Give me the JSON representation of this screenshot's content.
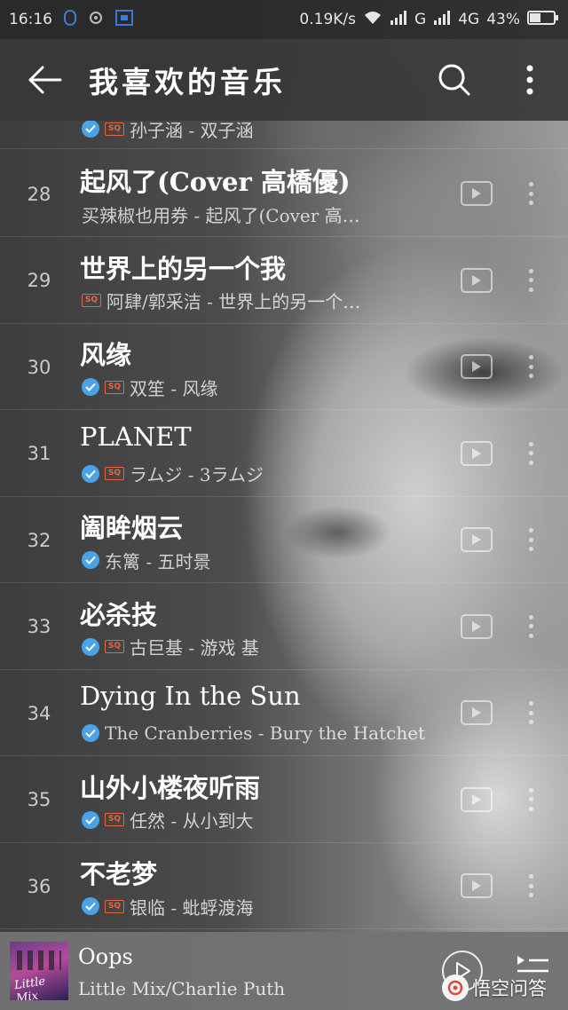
{
  "status_bar": {
    "time": "16:16",
    "net_speed": "0.19K/s",
    "sim1": "G",
    "sim2": "4G",
    "battery": "43%"
  },
  "header": {
    "title": "我喜欢的音乐",
    "back_icon": "arrow-left-icon",
    "search_icon": "search-icon",
    "more_icon": "more-vertical-icon"
  },
  "partial_song": {
    "subtitle": "孙子涵 - 双子涵",
    "verified": true,
    "sq": true
  },
  "songs": [
    {
      "index": "28",
      "title": "起风了(Cover 高橋優)",
      "subtitle": "买辣椒也用券 - 起风了(Cover 高…",
      "verified": false,
      "sq": false
    },
    {
      "index": "29",
      "title": "世界上的另一个我",
      "subtitle": "阿肆/郭采洁 - 世界上的另一个…",
      "verified": false,
      "sq": true
    },
    {
      "index": "30",
      "title": "风缘",
      "subtitle": "双笙 - 风缘",
      "verified": true,
      "sq": true
    },
    {
      "index": "31",
      "title": "PLANET",
      "subtitle": "ラムジ - 3ラムジ",
      "verified": true,
      "sq": true
    },
    {
      "index": "32",
      "title": "阖眸烟云",
      "subtitle": "东篱 - 五时景",
      "verified": true,
      "sq": false
    },
    {
      "index": "33",
      "title": "必杀技",
      "subtitle": "古巨基 - 游戏 基",
      "verified": true,
      "sq": true
    },
    {
      "index": "34",
      "title": "Dying In the Sun",
      "subtitle": "The Cranberries - Bury the Hatchet",
      "verified": true,
      "sq": false
    },
    {
      "index": "35",
      "title": "山外小楼夜听雨",
      "subtitle": "任然 - 从小到大",
      "verified": true,
      "sq": true
    },
    {
      "index": "36",
      "title": "不老梦",
      "subtitle": "银临 - 蚍蜉渡海",
      "verified": true,
      "sq": true
    }
  ],
  "sq_label": "SQ",
  "now_playing": {
    "title": "Oops",
    "artist": "Little Mix/Charlie Puth",
    "album_art_text": "Little Mix"
  },
  "watermark": {
    "text": "悟空问答"
  },
  "colors": {
    "verified_blue": "#4aa3e6",
    "sq_orange": "#e8663d"
  }
}
